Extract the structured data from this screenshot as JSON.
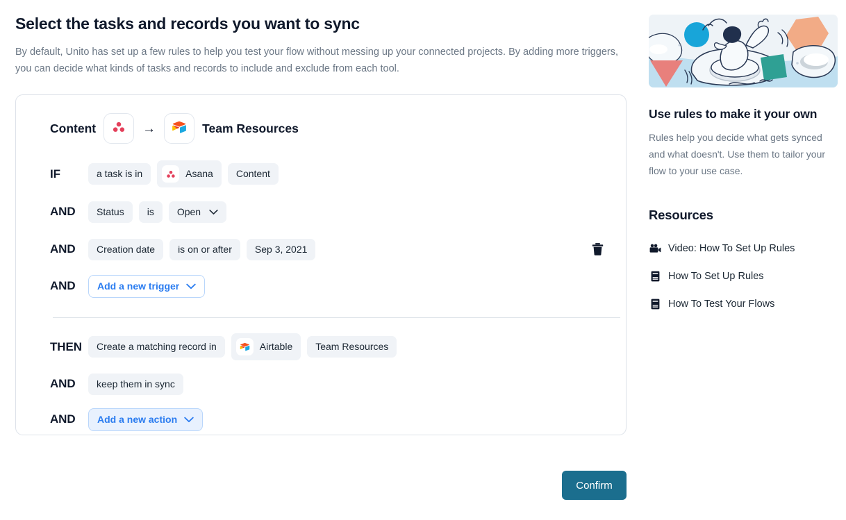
{
  "header": {
    "title": "Select the tasks and records you want to sync",
    "subtitle": "By default, Unito has set up a few rules to help you test your flow without messing up your connected projects. By adding more triggers, you can decide what kinds of tasks and records to include and exclude from each tool."
  },
  "rule_card": {
    "source_name": "Content",
    "source_tool": "Asana",
    "source_icon": "asana-icon",
    "arrow": "→",
    "target_name": "Team Resources",
    "target_tool": "Airtable",
    "target_icon": "airtable-icon",
    "triggers": [
      {
        "keyword": "IF",
        "pills": [
          {
            "label": "a task is in",
            "icon": null
          },
          {
            "label": "Asana",
            "icon": "asana-icon"
          },
          {
            "label": "Content",
            "icon": null
          }
        ],
        "has_delete": false
      },
      {
        "keyword": "AND",
        "pills": [
          {
            "label": "Status",
            "icon": null
          },
          {
            "label": "is",
            "icon": null
          },
          {
            "label": "Open",
            "icon": null,
            "dropdown": true
          }
        ],
        "has_delete": false
      },
      {
        "keyword": "AND",
        "pills": [
          {
            "label": "Creation date",
            "icon": null
          },
          {
            "label": "is on or after",
            "icon": null
          },
          {
            "label": "Sep 3, 2021",
            "icon": null
          }
        ],
        "has_delete": true,
        "delete_icon": "trash-icon"
      }
    ],
    "add_trigger": {
      "keyword": "AND",
      "label": "Add a new trigger"
    },
    "actions": [
      {
        "keyword": "THEN",
        "pills": [
          {
            "label": "Create a matching record in",
            "icon": null
          },
          {
            "label": "Airtable",
            "icon": "airtable-icon"
          },
          {
            "label": "Team Resources",
            "icon": null
          }
        ]
      },
      {
        "keyword": "AND",
        "pills": [
          {
            "label": "keep them in sync",
            "icon": null
          }
        ]
      }
    ],
    "add_action": {
      "keyword": "AND",
      "label": "Add a new action"
    }
  },
  "footer": {
    "confirm_label": "Confirm"
  },
  "sidebar": {
    "illustration_alt": "person floating on an inner tube with geometric shapes",
    "heading": "Use rules to make it your own",
    "paragraph": "Rules help you decide what gets synced and what doesn't. Use them to tailor your flow to your use case.",
    "resources_heading": "Resources",
    "resources": [
      {
        "label": "Video: How To Set Up Rules",
        "icon": "video-camera-icon"
      },
      {
        "label": "How To Set Up Rules",
        "icon": "book-icon"
      },
      {
        "label": "How To Test Your Flows",
        "icon": "book-icon"
      }
    ]
  },
  "colors": {
    "accent_blue": "#2a7cf0",
    "confirm_teal": "#1b6e8e",
    "pill_bg": "#f0f3f7",
    "card_border": "#dde2e9",
    "muted_text": "#6b7785"
  }
}
